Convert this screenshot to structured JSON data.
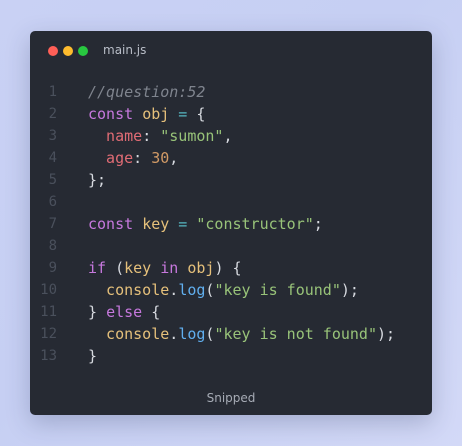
{
  "window": {
    "filename": "main.js",
    "footer": "Snipped"
  },
  "colors": {
    "comment": "#7f848e",
    "keyword": "#c678dd",
    "variable": "#e5c07b",
    "operator": "#56b6c2",
    "property": "#e06c75",
    "string": "#98c379",
    "number": "#d19a66",
    "function": "#61afef",
    "punctuation": "#d7dae0",
    "line_number": "#4a505c"
  },
  "code": {
    "lines": [
      {
        "num": "1",
        "tokens": [
          {
            "t": "//question:52",
            "c": "comment",
            "i": true
          }
        ]
      },
      {
        "num": "2",
        "tokens": [
          {
            "t": "const ",
            "c": "keyword"
          },
          {
            "t": "obj",
            "c": "variable"
          },
          {
            "t": " = ",
            "c": "operator"
          },
          {
            "t": "{",
            "c": "punctuation"
          }
        ]
      },
      {
        "num": "3",
        "tokens": [
          {
            "t": "  name",
            "c": "property"
          },
          {
            "t": ": ",
            "c": "punctuation"
          },
          {
            "t": "\"sumon\"",
            "c": "string"
          },
          {
            "t": ",",
            "c": "punctuation"
          }
        ]
      },
      {
        "num": "4",
        "tokens": [
          {
            "t": "  age",
            "c": "property"
          },
          {
            "t": ": ",
            "c": "punctuation"
          },
          {
            "t": "30",
            "c": "number"
          },
          {
            "t": ",",
            "c": "punctuation"
          }
        ]
      },
      {
        "num": "5",
        "tokens": [
          {
            "t": "};",
            "c": "punctuation"
          }
        ]
      },
      {
        "num": "6",
        "tokens": []
      },
      {
        "num": "7",
        "tokens": [
          {
            "t": "const ",
            "c": "keyword"
          },
          {
            "t": "key",
            "c": "variable"
          },
          {
            "t": " = ",
            "c": "operator"
          },
          {
            "t": "\"constructor\"",
            "c": "string"
          },
          {
            "t": ";",
            "c": "punctuation"
          }
        ]
      },
      {
        "num": "8",
        "tokens": []
      },
      {
        "num": "9",
        "tokens": [
          {
            "t": "if ",
            "c": "keyword"
          },
          {
            "t": "(",
            "c": "punctuation"
          },
          {
            "t": "key",
            "c": "variable"
          },
          {
            "t": " in ",
            "c": "keyword"
          },
          {
            "t": "obj",
            "c": "variable"
          },
          {
            "t": ") {",
            "c": "punctuation"
          }
        ]
      },
      {
        "num": "10",
        "tokens": [
          {
            "t": "  console",
            "c": "variable"
          },
          {
            "t": ".",
            "c": "punctuation"
          },
          {
            "t": "log",
            "c": "function"
          },
          {
            "t": "(",
            "c": "punctuation"
          },
          {
            "t": "\"key is found\"",
            "c": "string"
          },
          {
            "t": ");",
            "c": "punctuation"
          }
        ]
      },
      {
        "num": "11",
        "tokens": [
          {
            "t": "} ",
            "c": "punctuation"
          },
          {
            "t": "else",
            "c": "keyword"
          },
          {
            "t": " {",
            "c": "punctuation"
          }
        ]
      },
      {
        "num": "12",
        "tokens": [
          {
            "t": "  console",
            "c": "variable"
          },
          {
            "t": ".",
            "c": "punctuation"
          },
          {
            "t": "log",
            "c": "function"
          },
          {
            "t": "(",
            "c": "punctuation"
          },
          {
            "t": "\"key is not found\"",
            "c": "string"
          },
          {
            "t": ");",
            "c": "punctuation"
          }
        ]
      },
      {
        "num": "13",
        "tokens": [
          {
            "t": "}",
            "c": "punctuation"
          }
        ]
      }
    ]
  }
}
